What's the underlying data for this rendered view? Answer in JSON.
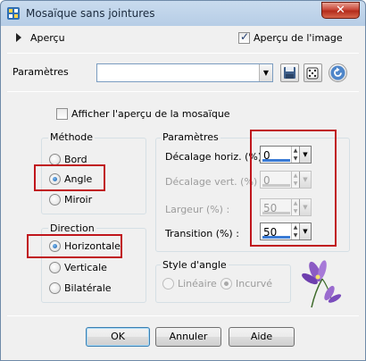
{
  "window": {
    "title": "Mosaïque sans jointures",
    "close_glyph": "✕"
  },
  "preview": {
    "label": "Aperçu",
    "image_preview_label": "Aperçu de l'image",
    "image_preview_checked": true
  },
  "presets": {
    "label": "Paramètres",
    "value": "",
    "icons": [
      "save-icon",
      "randomize-dice-icon",
      "reset-icon"
    ]
  },
  "mosaic_preview": {
    "label": "Afficher l'aperçu de la mosaïque",
    "checked": false
  },
  "method": {
    "title": "Méthode",
    "options": [
      "Bord",
      "Angle",
      "Miroir"
    ],
    "selected": "Angle"
  },
  "direction": {
    "title": "Direction",
    "options": [
      "Horizontale",
      "Verticale",
      "Bilatérale"
    ],
    "selected": "Horizontale"
  },
  "params": {
    "title": "Paramètres",
    "fields": [
      {
        "label": "Décalage horiz. (%) :",
        "value": "0",
        "enabled": true
      },
      {
        "label": "Décalage vert. (%) :",
        "value": "0",
        "enabled": false
      },
      {
        "label": "Largeur (%) :",
        "value": "50",
        "enabled": false
      },
      {
        "label": "Transition (%) :",
        "value": "50",
        "enabled": true
      }
    ]
  },
  "corner_style": {
    "title": "Style d'angle",
    "options": [
      "Linéaire",
      "Incurvé"
    ],
    "selected": "Incurvé",
    "enabled": false
  },
  "buttons": {
    "ok": "OK",
    "cancel": "Annuler",
    "help": "Aide"
  },
  "colors": {
    "highlight_box": "#c0161c",
    "accent": "#3a7bd5"
  }
}
